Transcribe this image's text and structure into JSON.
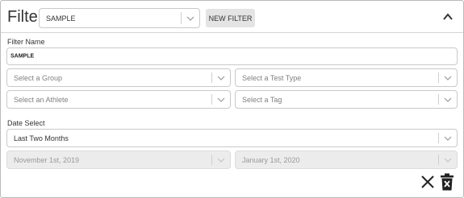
{
  "header": {
    "title": "Filter",
    "filter_select": {
      "value": "SAMPLE"
    },
    "new_filter_label": "NEW FILTER"
  },
  "form": {
    "filter_name": {
      "label": "Filter Name",
      "value": "SAMPLE"
    },
    "group_select": {
      "placeholder": "Select a Group"
    },
    "test_type_select": {
      "placeholder": "Select a Test Type"
    },
    "athlete_select": {
      "placeholder": "Select an Athlete"
    },
    "tag_select": {
      "placeholder": "Select a Tag"
    },
    "date_select": {
      "label": "Date Select",
      "value": "Last Two Months"
    },
    "start_date": {
      "value": "November 1st, 2019"
    },
    "end_date": {
      "value": "January 1st, 2020"
    }
  },
  "icons": {
    "collapse": "chevron-up-icon",
    "chevron": "chevron-down-icon",
    "close": "close-icon",
    "delete": "trash-icon"
  }
}
